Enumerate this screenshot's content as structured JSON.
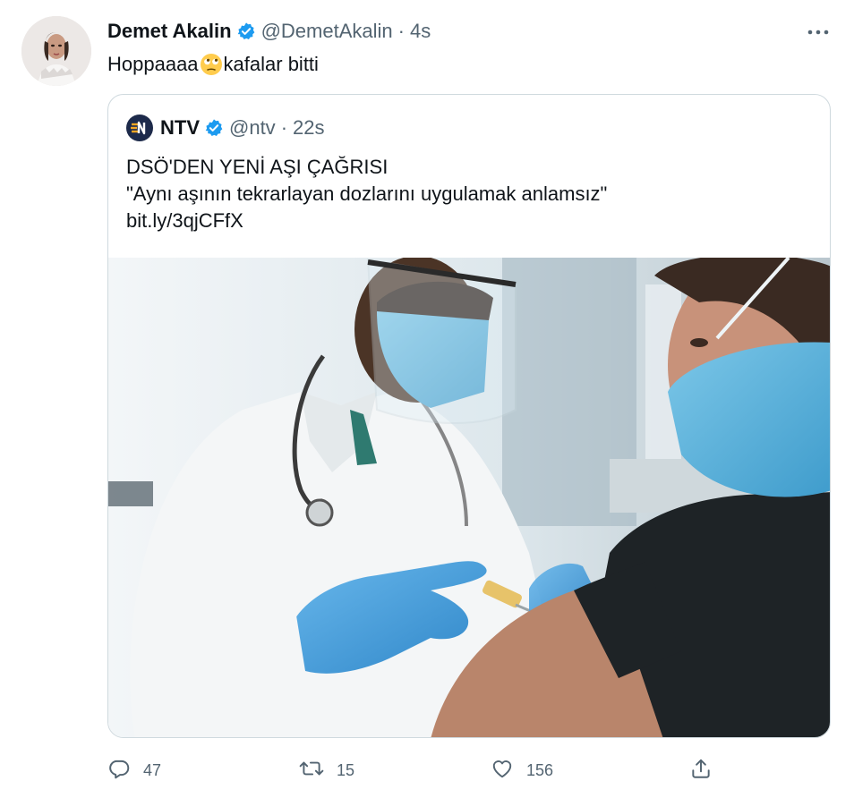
{
  "tweet": {
    "author_name": "Demet Akalin",
    "handle": "@DemetAkalin",
    "separator": "·",
    "time": "4s",
    "text_before": "Hoppaaaa",
    "emoji": "face-with-rolling-eyes",
    "text_after": "kafalar bitti"
  },
  "quote": {
    "author_name": "NTV",
    "handle": "@ntv",
    "separator": "·",
    "time": "22s",
    "lines": [
      "DSÖ'DEN YENİ AŞI ÇAĞRISI",
      "\"Aynı aşının tekrarlayan dozlarını uygulamak anlamsız\"",
      "bit.ly/3qjCFfX"
    ],
    "media": "photo-doctor-vaccinating-masked-woman"
  },
  "actions": {
    "reply_count": "47",
    "retweet_count": "15",
    "like_count": "156"
  },
  "icons": {
    "verified": "verified-badge-icon",
    "more": "more-dots-icon",
    "reply": "reply-icon",
    "retweet": "retweet-icon",
    "like": "heart-icon",
    "share": "share-icon"
  },
  "colors": {
    "verified_blue": "#1d9bf0",
    "secondary_text": "#536471",
    "border": "#cfd9de"
  }
}
